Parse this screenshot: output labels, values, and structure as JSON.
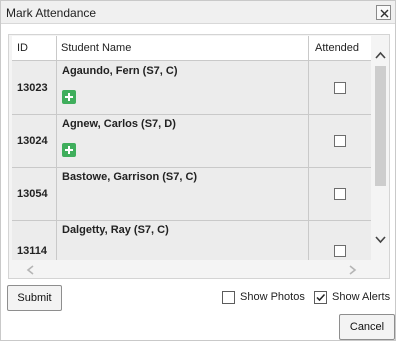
{
  "dialog": {
    "title": "Mark Attendance"
  },
  "table": {
    "headers": {
      "id": "ID",
      "student_name": "Student Name",
      "attended": "Attended"
    },
    "rows": [
      {
        "id": "13023",
        "name": "Agaundo, Fern (S7, C)",
        "attended": false,
        "has_plus": true
      },
      {
        "id": "13024",
        "name": "Agnew, Carlos (S7, D)",
        "attended": false,
        "has_plus": true
      },
      {
        "id": "13054",
        "name": "Bastowe, Garrison (S7, C)",
        "attended": false,
        "has_plus": false
      },
      {
        "id": "13114",
        "name": "Dalgetty, Ray (S7, C)",
        "attended": false,
        "has_plus": false
      }
    ]
  },
  "footer": {
    "submit_label": "Submit",
    "cancel_label": "Cancel",
    "show_photos": {
      "label": "Show Photos",
      "checked": false
    },
    "show_alerts": {
      "label": "Show Alerts",
      "checked": true
    }
  },
  "colors": {
    "plus_icon": "#3fae5c",
    "row_bg": "#ececec",
    "titlebar_bg": "#f0f0f0"
  }
}
